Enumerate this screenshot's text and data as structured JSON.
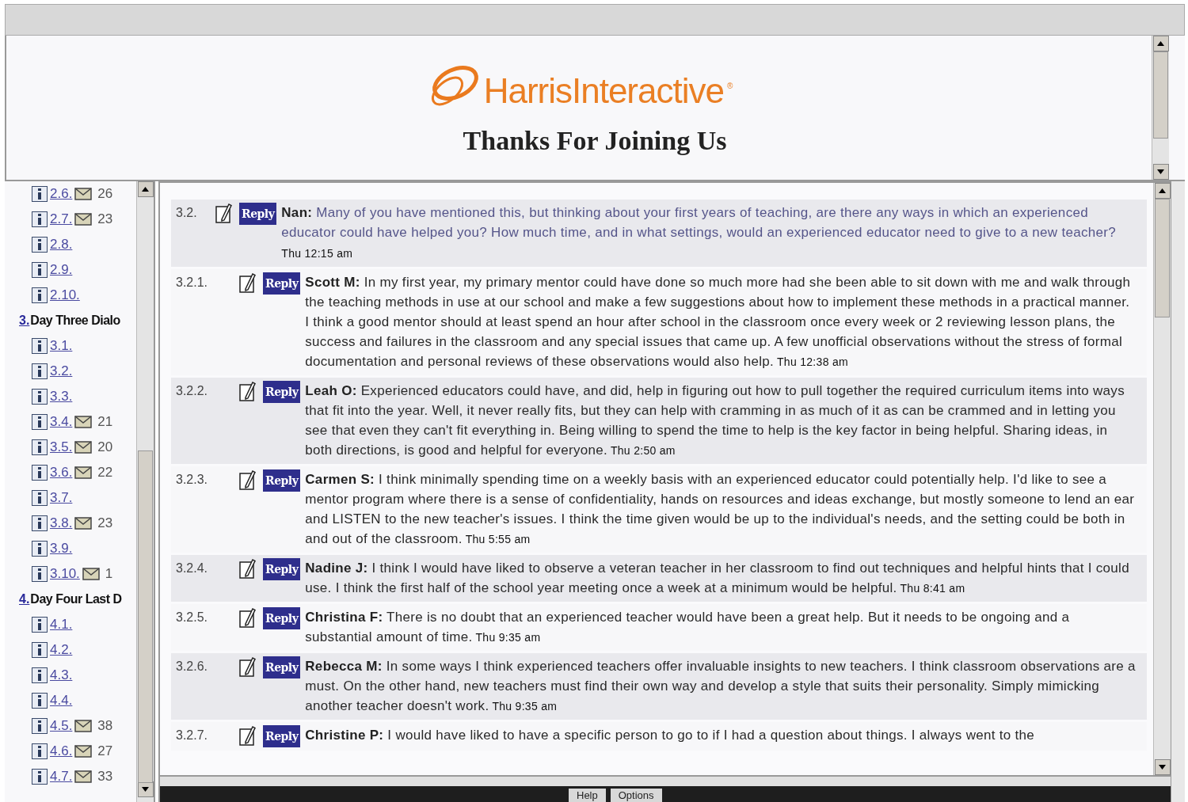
{
  "header": {
    "logo": "HarrisInteractive",
    "logo_mark": "®",
    "title": "Thanks For Joining Us"
  },
  "sidebar": {
    "groups": [
      {
        "items": [
          {
            "label": "2.6.",
            "count": "26"
          },
          {
            "label": "2.7.",
            "count": "23"
          },
          {
            "label": "2.8."
          },
          {
            "label": "2.9."
          },
          {
            "label": "2.10."
          }
        ]
      },
      {
        "number": "3.",
        "title": "Day Three Dialo",
        "items": [
          {
            "label": "3.1."
          },
          {
            "label": "3.2."
          },
          {
            "label": "3.3."
          },
          {
            "label": "3.4.",
            "count": "21"
          },
          {
            "label": "3.5.",
            "count": "20"
          },
          {
            "label": "3.6.",
            "count": "22"
          },
          {
            "label": "3.7."
          },
          {
            "label": "3.8.",
            "count": "23"
          },
          {
            "label": "3.9."
          },
          {
            "label": "3.10.",
            "count": "1"
          }
        ]
      },
      {
        "number": "4.",
        "title": "Day Four Last D",
        "items": [
          {
            "label": "4.1."
          },
          {
            "label": "4.2."
          },
          {
            "label": "4.3."
          },
          {
            "label": "4.4."
          },
          {
            "label": "4.5.",
            "count": "38"
          },
          {
            "label": "4.6.",
            "count": "27"
          },
          {
            "label": "4.7.",
            "count": "33"
          }
        ]
      }
    ]
  },
  "thread": {
    "posts": [
      {
        "number": "3.2.",
        "kind": "question",
        "reply_label": "Reply",
        "author": "Nan:",
        "text": "Many of you have mentioned this, but thinking about your first years of teaching, are there any ways in which an experienced educator could have helped you? How much time, and in what settings, would an experienced educator need to give to a new teacher?",
        "time": "Thu 12:15 am",
        "children": [
          {
            "number": "3.2.1.",
            "kind": "reply",
            "reply_label": "Reply",
            "author": "Scott M:",
            "text": "In my first year, my primary mentor could have done so much more had she been able to sit down with me and walk through the teaching methods in use at our school and make a few suggestions about how to implement these methods in a practical manner. I think a good mentor should at least spend an hour after school in the classroom once every week or 2 reviewing lesson plans, the success and failures in the classroom and any special issues that came up. A few unofficial observations without the stress of formal documentation and personal reviews of these observations would also help.",
            "time": "Thu 12:38 am"
          },
          {
            "number": "3.2.2.",
            "kind": "reply",
            "reply_label": "Reply",
            "author": "Leah O:",
            "text": "Experienced educators could have, and did, help in figuring out how to pull together the required curriculum items into ways that fit into the year. Well, it never really fits, but they can help with cramming in as much of it as can be crammed and in letting you see that even they can't fit everything in. Being willing to spend the time to help is the key factor in being helpful. Sharing ideas, in both directions, is good and helpful for everyone.",
            "time": "Thu 2:50 am"
          },
          {
            "number": "3.2.3.",
            "kind": "reply",
            "reply_label": "Reply",
            "author": "Carmen S:",
            "text": "I think minimally spending time on a weekly basis with an experienced educator could potentially help. I'd like to see a mentor program where there is a sense of confidentiality, hands on resources and ideas exchange, but mostly someone to lend an ear and LISTEN to the new teacher's issues. I think the time given would be up to the individual's needs, and the setting could be both in and out of the classroom.",
            "time": "Thu 5:55 am"
          },
          {
            "number": "3.2.4.",
            "kind": "reply",
            "reply_label": "Reply",
            "author": "Nadine J:",
            "text": "I think I would have liked to observe a veteran teacher in her classroom to find out techniques and helpful hints that I could use. I think the first half of the school year meeting once a week at a minimum would be helpful.",
            "time": "Thu 8:41 am"
          },
          {
            "number": "3.2.5.",
            "kind": "reply",
            "reply_label": "Reply",
            "author": "Christina F:",
            "text": "There is no doubt that an experienced teacher would have been a great help. But it needs to be ongoing and a substantial amount of time.",
            "time": "Thu 9:35 am"
          },
          {
            "number": "3.2.6.",
            "kind": "reply",
            "reply_label": "Reply",
            "author": "Rebecca M:",
            "text": "In some ways I think experienced teachers offer invaluable insights to new teachers. I think classroom observations are a must. On the other hand, new teachers must find their own way and develop a style that suits their personality. Simply mimicking another teacher doesn't work.",
            "time": "Thu 9:35 am"
          },
          {
            "number": "3.2.7.",
            "kind": "reply",
            "reply_label": "Reply",
            "author": "Christine P:",
            "text": "I would have liked to have a specific person to go to if I had a question about things. I always went to the"
          }
        ]
      }
    ]
  },
  "footer": {
    "buttons": [
      "Help",
      "Options"
    ]
  }
}
